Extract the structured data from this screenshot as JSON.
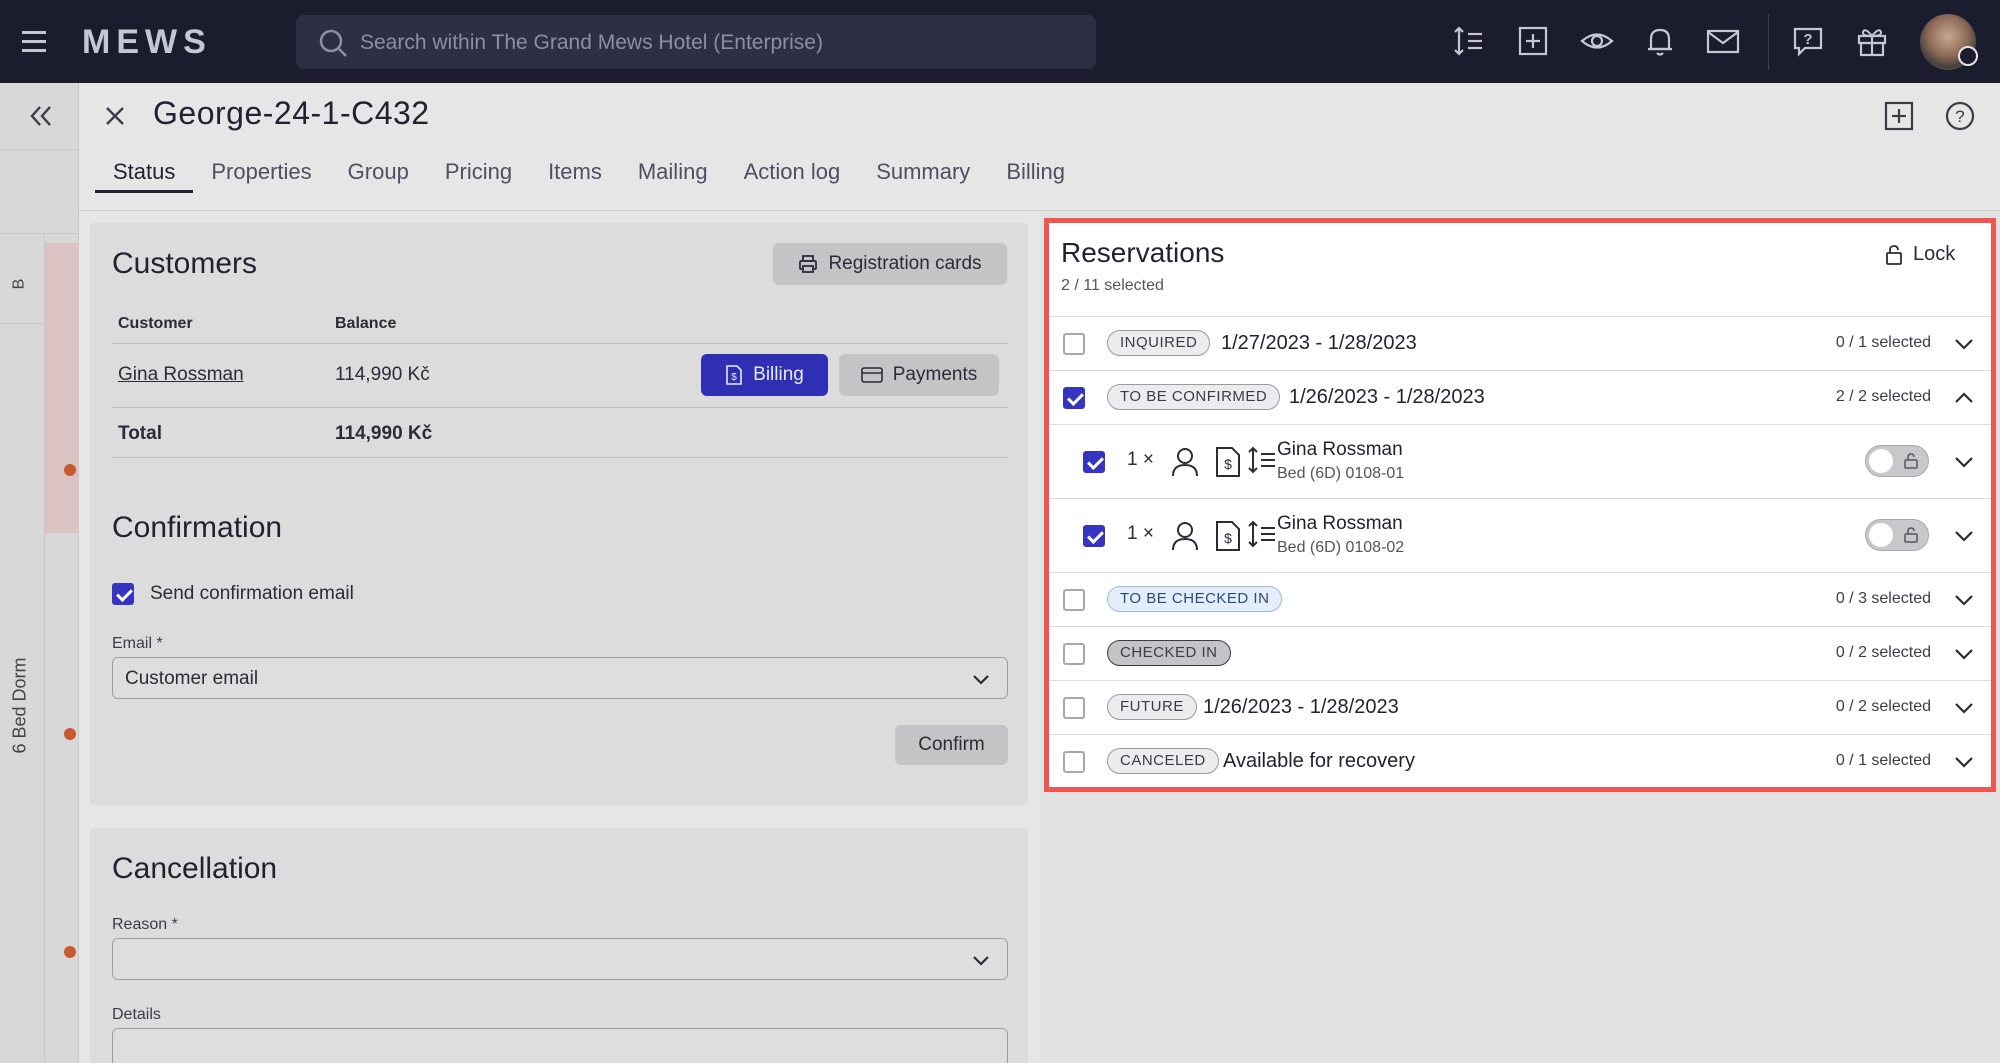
{
  "topbar": {
    "logo": "MEWS",
    "search_placeholder": "Search within The Grand Mews Hotel (Enterprise)"
  },
  "sidebar": {
    "strip_label_top": "B",
    "strip_label_dorm": "6 Bed Dorm"
  },
  "header": {
    "title": "George-24-1-C432",
    "tabs": [
      "Status",
      "Properties",
      "Group",
      "Pricing",
      "Items",
      "Mailing",
      "Action log",
      "Summary",
      "Billing"
    ]
  },
  "customers": {
    "title": "Customers",
    "registration_cards_label": "Registration cards",
    "col_customer": "Customer",
    "col_balance": "Balance",
    "row_name": "Gina Rossman",
    "row_balance": "114,990 Kč",
    "billing_label": "Billing",
    "payments_label": "Payments",
    "total_label": "Total",
    "total_value": "114,990 Kč"
  },
  "confirmation": {
    "title": "Confirmation",
    "send_email_label": "Send confirmation email",
    "email_label": "Email *",
    "email_value": "Customer email",
    "confirm_label": "Confirm"
  },
  "cancellation": {
    "title": "Cancellation",
    "reason_label": "Reason *",
    "details_label": "Details"
  },
  "reservations": {
    "title": "Reservations",
    "selected_summary": "2 / 11 selected",
    "lock_label": "Lock",
    "groups": [
      {
        "status": "INQUIRED",
        "dates": "1/27/2023 - 1/28/2023",
        "count": "0 / 1 selected"
      },
      {
        "status": "TO BE CONFIRMED",
        "dates": "1/26/2023 - 1/28/2023",
        "count": "2 / 2 selected"
      },
      {
        "status": "TO BE CHECKED IN",
        "dates": "",
        "count": "0 / 3 selected"
      },
      {
        "status": "CHECKED IN",
        "dates": "",
        "count": "0 / 2 selected"
      },
      {
        "status": "FUTURE",
        "dates": "1/26/2023 - 1/28/2023",
        "count": "0 / 2 selected"
      },
      {
        "status": "CANCELED",
        "dates": "Available for recovery",
        "count": "0 / 1 selected"
      }
    ],
    "items": [
      {
        "qty": "1 ×",
        "name": "Gina Rossman",
        "bed": "Bed (6D) 0108-01"
      },
      {
        "qty": "1 ×",
        "name": "Gina Rossman",
        "bed": "Bed (6D) 0108-02"
      }
    ]
  },
  "colors": {
    "topbar": "#1b1c2e",
    "accent": "#3535c2",
    "highlight_border": "#f0564f"
  }
}
